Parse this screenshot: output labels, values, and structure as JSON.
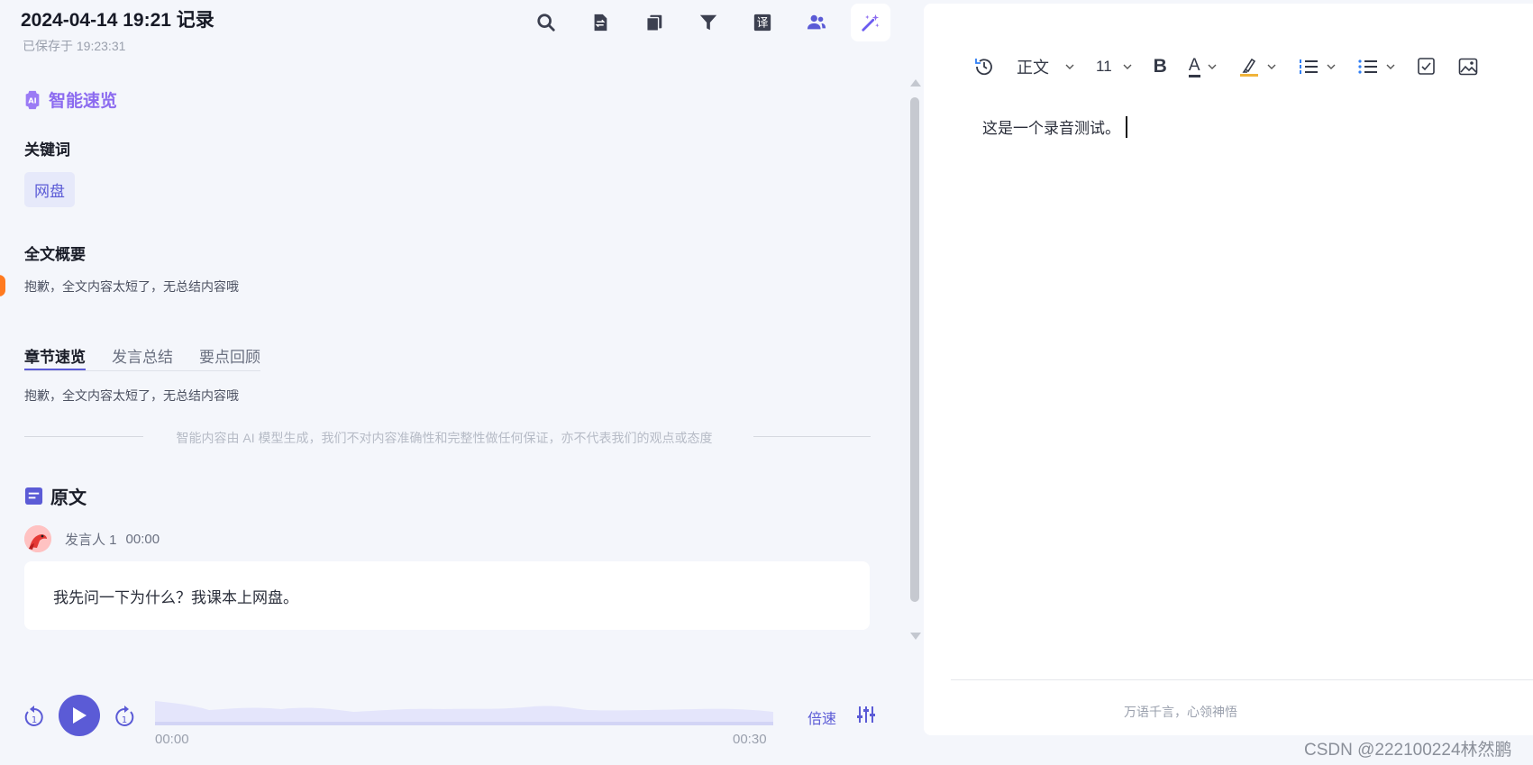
{
  "header": {
    "title": "2024-04-14 19:21 记录",
    "saved": "已保存于 19:23:31"
  },
  "toolbar": {
    "icons": [
      "search-icon",
      "file-swap-icon",
      "copy-icon",
      "filter-icon",
      "translate-icon",
      "people-icon",
      "magic-wand-icon"
    ],
    "translate_glyph": "译",
    "accent": "#5b5bd6"
  },
  "ai_summary": {
    "label": "智能速览",
    "keywords_label": "关键词",
    "keyword": "网盘",
    "overview_label": "全文概要",
    "overview_text": "抱歉，全文内容太短了，无总结内容哦",
    "tabs": [
      "章节速览",
      "发言总结",
      "要点回顾"
    ],
    "active_tab": 0,
    "tab_text": "抱歉，全文内容太短了，无总结内容哦",
    "disclaimer": "智能内容由 AI 模型生成，我们不对内容准确性和完整性做任何保证，亦不代表我们的观点或态度"
  },
  "original": {
    "label": "原文",
    "speaker_name": "发言人 1",
    "speaker_time": "00:00",
    "text": "我先问一下为什么？我课本上网盘。"
  },
  "player": {
    "current_time": "00:00",
    "total_time": "00:30",
    "speed_label": "倍速",
    "progress": 0,
    "skip_label": "1"
  },
  "editor": {
    "style_label": "正文",
    "font_size": "11",
    "bold_label": "B",
    "font_color_label": "A",
    "content": "这是一个录音测试。",
    "footer": "万语千言，心领神悟"
  },
  "watermark": "CSDN @222100224林然鹏"
}
